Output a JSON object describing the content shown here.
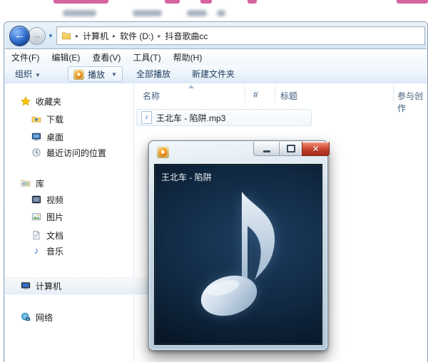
{
  "background": {
    "accent_color": "#d7639f"
  },
  "icons": {
    "caret_down": "▼",
    "crumb_sep": "▸",
    "back_arrow": "←",
    "forward_arrow": "→",
    "music_note": "♪",
    "close_glyph": "✕"
  },
  "explorer": {
    "address": {
      "crumbs": [
        "计算机",
        "软件 (D:)",
        "抖音歌曲cc"
      ]
    },
    "menu": {
      "items": [
        "文件(F)",
        "编辑(E)",
        "查看(V)",
        "工具(T)",
        "帮助(H)"
      ]
    },
    "toolbar": {
      "organize": "组织",
      "play": "播放",
      "play_all": "全部播放",
      "new_folder": "新建文件夹"
    },
    "sidebar": {
      "items": [
        {
          "label": "收藏夹"
        },
        {
          "label": "下载"
        },
        {
          "label": "桌面"
        },
        {
          "label": "最近访问的位置"
        },
        {
          "label": "库"
        },
        {
          "label": "视频"
        },
        {
          "label": "图片"
        },
        {
          "label": "文档"
        },
        {
          "label": "音乐"
        },
        {
          "label": "计算机"
        },
        {
          "label": "网络"
        }
      ],
      "selected_item": "计算机"
    },
    "list": {
      "columns": [
        "名称",
        "#",
        "标题",
        "参与创作"
      ],
      "files": [
        {
          "name": "王北车 - 陷阱.mp3"
        }
      ]
    }
  },
  "player": {
    "song_title": "王北车 - 陷阱"
  },
  "colors": {
    "close_button": "#c83a28",
    "wmp_orange": "#e98a12",
    "note": "#c9d9e8",
    "player_screen": "#0d2036"
  }
}
